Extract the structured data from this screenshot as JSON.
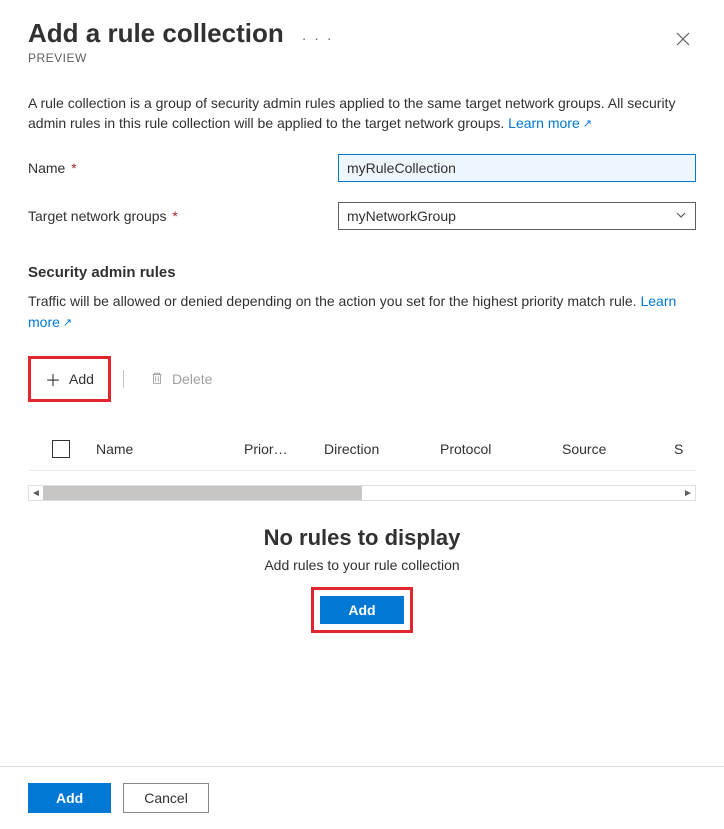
{
  "header": {
    "title": "Add a rule collection",
    "subtitle": "PREVIEW",
    "more": "· · ·"
  },
  "description": {
    "text": "A rule collection is a group of security admin rules applied to the same target network groups. All security admin rules in this rule collection will be applied to the target network groups. ",
    "learn_more": "Learn more"
  },
  "form": {
    "name_label": "Name",
    "name_value": "myRuleCollection",
    "target_label": "Target network groups",
    "target_value": "myNetworkGroup"
  },
  "section": {
    "heading": "Security admin rules",
    "subtext": "Traffic will be allowed or denied depending on the action you set for the highest priority match rule. ",
    "learn_more": "Learn more"
  },
  "toolbar": {
    "add": "Add",
    "delete": "Delete"
  },
  "table": {
    "columns": {
      "name": "Name",
      "priority": "Prior…",
      "direction": "Direction",
      "protocol": "Protocol",
      "source": "Source",
      "last": "S"
    }
  },
  "empty": {
    "title": "No rules to display",
    "subtitle": "Add rules to your rule collection",
    "button": "Add"
  },
  "footer": {
    "add": "Add",
    "cancel": "Cancel"
  }
}
